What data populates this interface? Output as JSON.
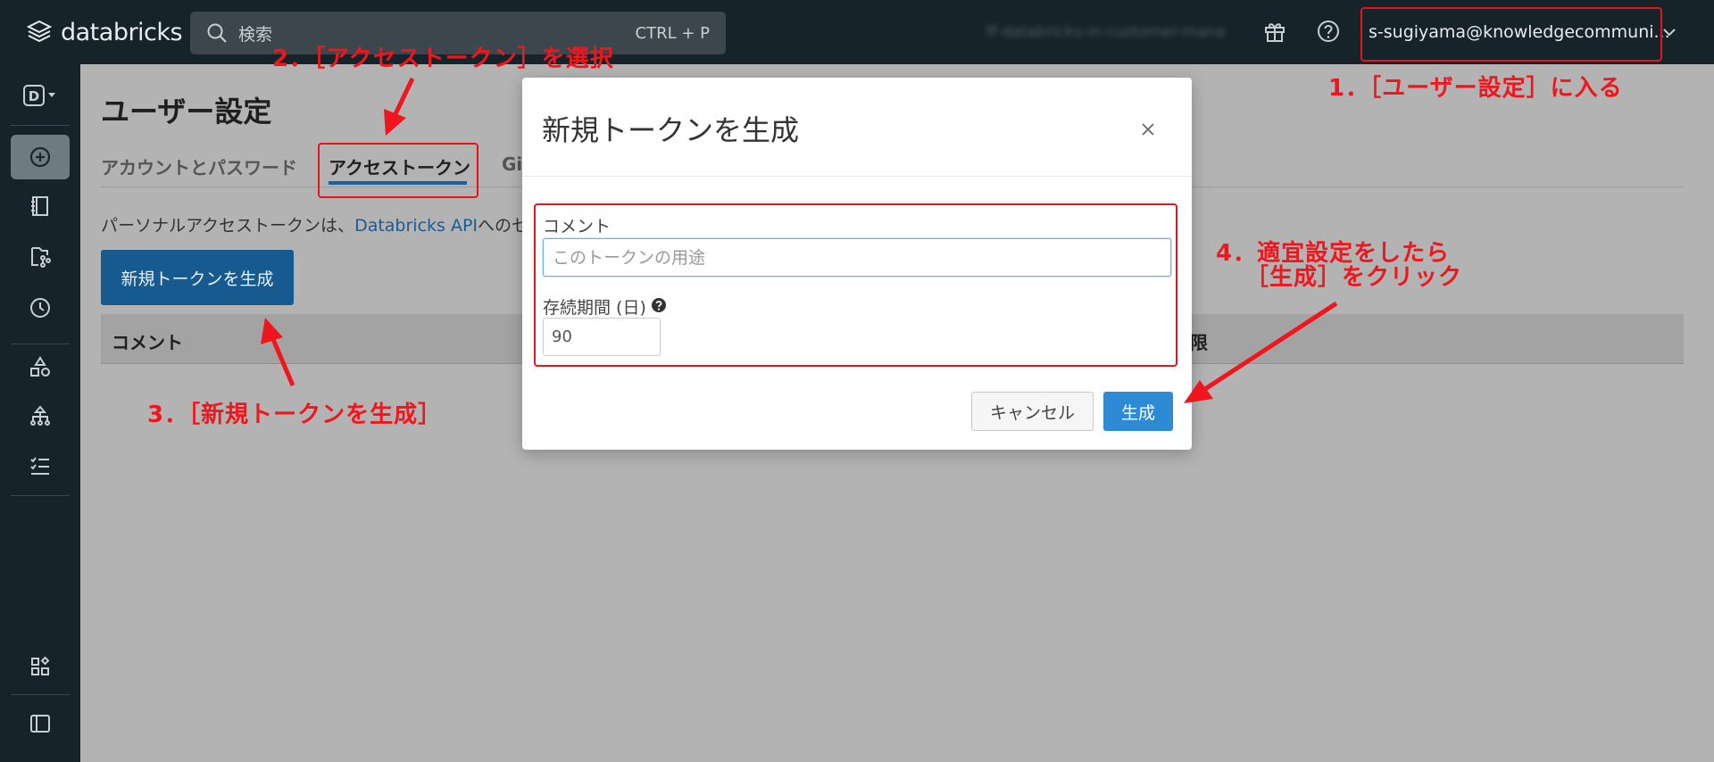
{
  "header": {
    "logo_text": "databricks",
    "search_placeholder": "検索",
    "search_shortcut": "CTRL + P",
    "workspace_blurred": "ff-databricks-in-customer-mana",
    "user_email": "s-sugiyama@knowledgecommuni..."
  },
  "sidebar": {
    "workspace_badge": "D"
  },
  "page": {
    "title": "ユーザー設定",
    "tabs": [
      {
        "label": "アカウントとパスワード",
        "active": false
      },
      {
        "label": "アクセストークン",
        "active": true
      },
      {
        "label": "Git",
        "active": false
      }
    ],
    "description_prefix": "パーソナルアクセストークンは、",
    "description_link": "Databricks API",
    "description_suffix": "へのセ",
    "new_token_button": "新規トークンを生成",
    "table_headers": [
      "コメント",
      "限"
    ]
  },
  "modal": {
    "title": "新規トークンを生成",
    "comment_label": "コメント",
    "comment_placeholder": "このトークンの用途",
    "lifetime_label": "存続期間 (日)",
    "lifetime_value": "90",
    "cancel_label": "キャンセル",
    "generate_label": "生成"
  },
  "annotations": {
    "step1": "1．［ユーザー設定］に入る",
    "step2": "2．［アクセストークン］を選択",
    "step3": "3．［新規トークンを生成］",
    "step4_line1": "4．適宜設定をしたら",
    "step4_line2": "［生成］をクリック",
    "color": "#f0161d"
  }
}
